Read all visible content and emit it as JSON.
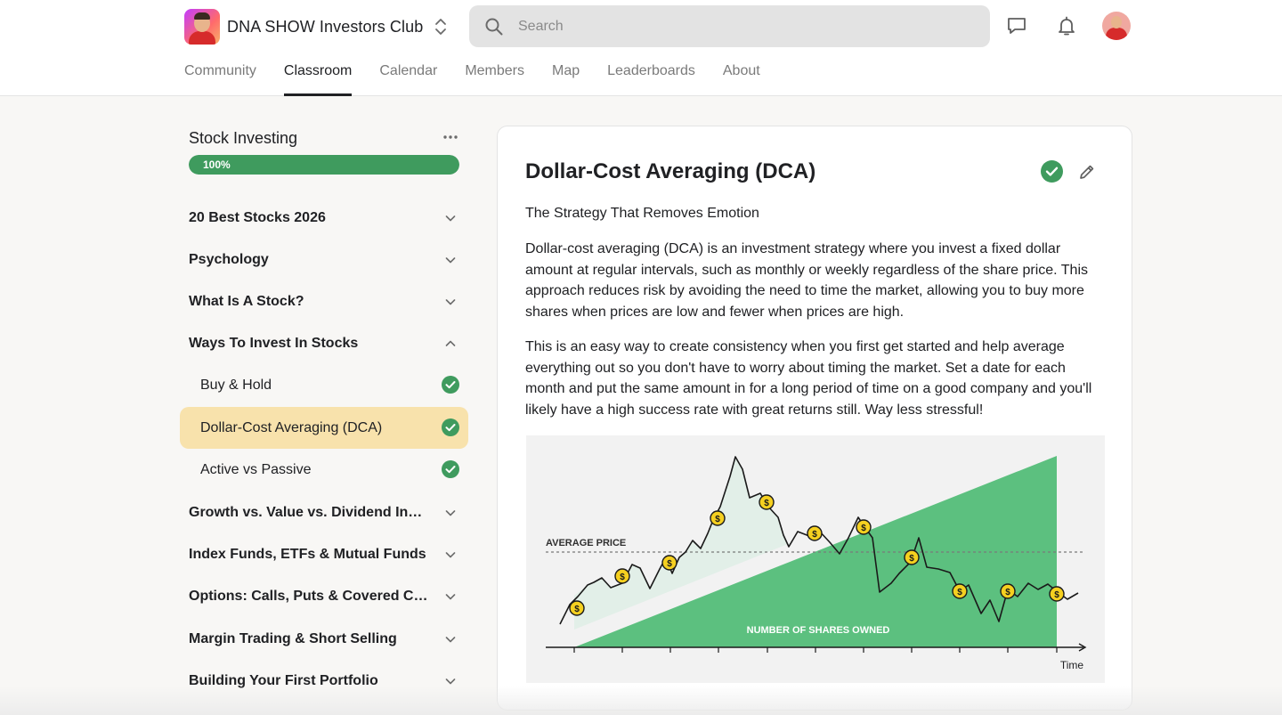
{
  "app": {
    "name": "DNA SHOW Investors Club"
  },
  "search": {
    "placeholder": "Search"
  },
  "nav": {
    "tabs": [
      {
        "label": "Community",
        "active": false
      },
      {
        "label": "Classroom",
        "active": true
      },
      {
        "label": "Calendar",
        "active": false
      },
      {
        "label": "Members",
        "active": false
      },
      {
        "label": "Map",
        "active": false
      },
      {
        "label": "Leaderboards",
        "active": false
      },
      {
        "label": "About",
        "active": false
      }
    ]
  },
  "sidebar": {
    "course_title": "Stock Investing",
    "progress_percent": 100,
    "progress_label": "100%",
    "modules": [
      {
        "label": "20 Best Stocks 2026",
        "expanded": false
      },
      {
        "label": "Psychology",
        "expanded": false
      },
      {
        "label": "What Is A Stock?",
        "expanded": false
      },
      {
        "label": "Ways To Invest In Stocks",
        "expanded": true
      },
      {
        "label": "Growth vs. Value vs. Dividend Investing",
        "expanded": false
      },
      {
        "label": "Index Funds, ETFs & Mutual Funds",
        "expanded": false
      },
      {
        "label": "Options: Calls, Puts & Covered Calls",
        "expanded": false
      },
      {
        "label": "Margin Trading & Short Selling",
        "expanded": false
      },
      {
        "label": "Building Your First Portfolio",
        "expanded": false
      }
    ],
    "lessons": [
      {
        "label": "Buy & Hold",
        "completed": true,
        "active": false
      },
      {
        "label": "Dollar-Cost Averaging (DCA)",
        "completed": true,
        "active": true
      },
      {
        "label": "Active vs Passive",
        "completed": true,
        "active": false
      }
    ]
  },
  "lesson": {
    "title": "Dollar-Cost Averaging (DCA)",
    "completed": true,
    "subtitle": "The Strategy That Removes Emotion",
    "paragraphs": [
      "Dollar-cost averaging (DCA) is an investment strategy where you invest a fixed dollar amount at regular intervals, such as monthly or weekly regardless of the share price. This approach reduces risk by avoiding the need to time the market, allowing you to buy more shares when prices are low and fewer when prices are high.",
      "This is an easy way to create consistency when you first get started and help average everything out so you don't have to worry about timing the market. Set a date for each month and put the same amount in for a long period of time on a good company and you'll likely have a high success rate with great returns still. Way less stressful!"
    ]
  },
  "illustration": {
    "average_price_label": "AVERAGE PRICE",
    "shares_label": "NUMBER OF SHARES OWNED",
    "x_axis_label": "Time",
    "coin_symbol": "$"
  },
  "colors": {
    "accent_green": "#3f9b5e",
    "active_lesson_bg": "#f8e2ac",
    "shares_area": "#5cc07f",
    "coin_yellow": "#f5d020"
  }
}
